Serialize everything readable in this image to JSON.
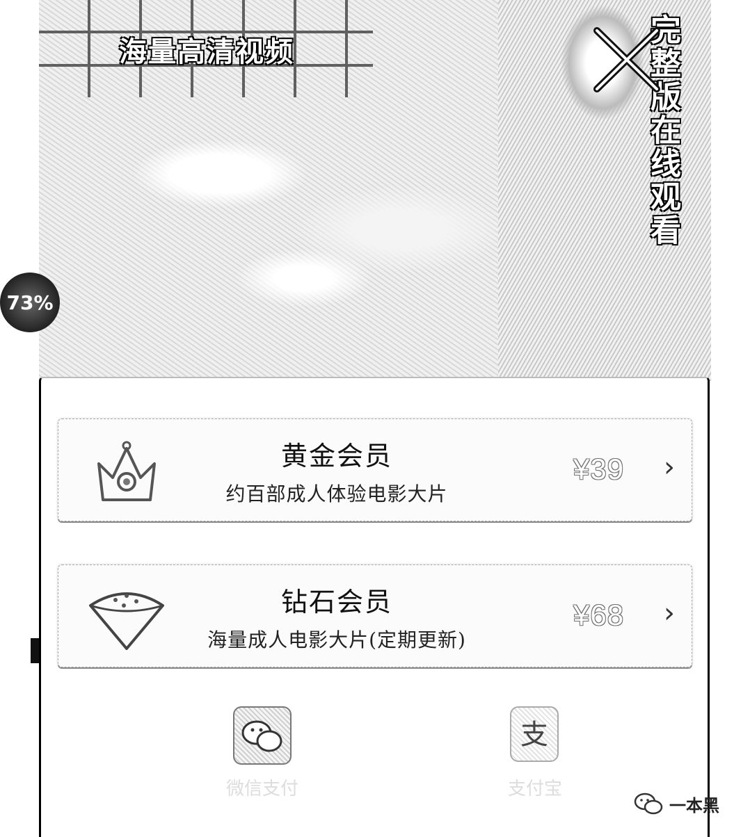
{
  "banner": {
    "title": "海量高清视频",
    "side_text": "完整版在线观看",
    "progress_percent": 73,
    "progress_label": "73%",
    "close_icon": "close-icon"
  },
  "plans": [
    {
      "icon": "crown-icon",
      "title": "黄金会员",
      "description": "约百部成人体验电影大片",
      "price": "¥39",
      "chevron": "›"
    },
    {
      "icon": "diamond-icon",
      "title": "钻石会员",
      "description": "海量成人电影大片(定期更新)",
      "price": "¥68",
      "chevron": "›"
    }
  ],
  "payment": {
    "options": [
      {
        "icon": "wechat-pay-icon",
        "label": "微信支付"
      },
      {
        "icon": "alipay-icon",
        "label": "支付宝"
      }
    ]
  },
  "watermark": {
    "icon": "wechat-icon",
    "text": "一本黑"
  }
}
